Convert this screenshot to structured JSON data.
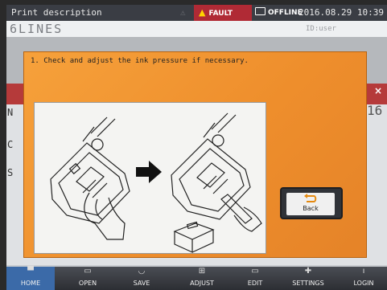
{
  "topbar": {
    "title": "Print description",
    "fault_label": "FAULT",
    "offline_label": "OFFLINE",
    "datetime": "2016.08.29 10:39"
  },
  "namebar": {
    "message_name": "6LINES",
    "user_id": "ID:user"
  },
  "background": {
    "side_letters": [
      "N",
      "C",
      "S"
    ],
    "right_number": "16"
  },
  "dialog": {
    "instruction": "1. Check and adjust the ink pressure if necessary.",
    "back_label": "Back"
  },
  "bottom_nav": {
    "items": [
      {
        "label": "HOME",
        "icon": "home-icon",
        "active": true
      },
      {
        "label": "OPEN",
        "icon": "open-icon",
        "active": false
      },
      {
        "label": "SAVE",
        "icon": "save-icon",
        "active": false
      },
      {
        "label": "ADJUST",
        "icon": "adjust-icon",
        "active": false
      },
      {
        "label": "EDIT",
        "icon": "edit-icon",
        "active": false
      },
      {
        "label": "SETTINGS",
        "icon": "settings-icon",
        "active": false
      },
      {
        "label": "LOGIN",
        "icon": "login-icon",
        "active": false
      }
    ]
  },
  "colors": {
    "dialog_orange": "#f19530",
    "fault_red": "#b02a35",
    "nav_active": "#3b6aa8"
  }
}
